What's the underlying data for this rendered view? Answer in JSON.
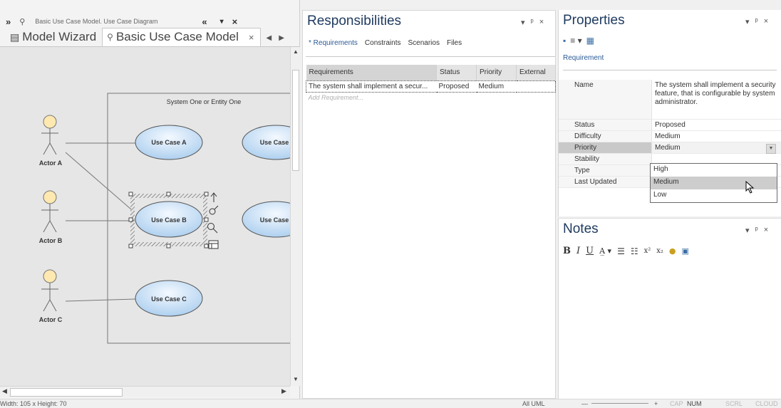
{
  "diagram_window": {
    "header_expand": "»",
    "header_title": "Basic Use Case Model.  Use Case Diagram",
    "header_collapse": "«",
    "header_menu": "▾",
    "header_close": "×",
    "tabs": [
      {
        "label": "Model Wizard",
        "icon": "model-wizard-icon"
      },
      {
        "label": "Basic Use Case Model",
        "icon": "use-case-model-icon"
      }
    ],
    "tab_close": "×",
    "tab_prev": "◀",
    "tab_next": "▶"
  },
  "diagram": {
    "boundary_label": "System One or Entity One",
    "actors": [
      {
        "label": "Actor A"
      },
      {
        "label": "Actor B"
      },
      {
        "label": "Actor C"
      }
    ],
    "use_cases": [
      {
        "label": "Use Case A"
      },
      {
        "label": "Use Case"
      },
      {
        "label": "Use Case B"
      },
      {
        "label": "Use Case"
      },
      {
        "label": "Use Case C"
      }
    ]
  },
  "responsibilities": {
    "title": "Responsibilities",
    "controls": [
      "▾",
      "ᵖ",
      "×"
    ],
    "tabs": [
      "* Requirements",
      "Constraints",
      "Scenarios",
      "Files"
    ],
    "columns": [
      "Requirements",
      "Status",
      "Priority",
      "External"
    ],
    "rows": [
      {
        "requirement": "The system shall implement a secur...",
        "status": "Proposed",
        "priority": "Medium",
        "external": ""
      }
    ],
    "add_placeholder": "Add Requirement..."
  },
  "properties": {
    "title": "Properties",
    "controls": [
      "▾",
      "ᵖ",
      "×"
    ],
    "tab": "Requirement",
    "rows": [
      {
        "key": "Name",
        "value": "The system shall implement a security feature, that is configurable by system administrator."
      },
      {
        "key": "Status",
        "value": "Proposed"
      },
      {
        "key": "Difficulty",
        "value": "Medium"
      },
      {
        "key": "Priority",
        "value": "Medium"
      },
      {
        "key": "Stability",
        "value": ""
      },
      {
        "key": "Type",
        "value": ""
      },
      {
        "key": "Last Updated",
        "value": ""
      }
    ],
    "priority_options": [
      "High",
      "Medium",
      "Low"
    ],
    "priority_selected": "Medium"
  },
  "notes": {
    "title": "Notes",
    "controls": [
      "▾",
      "ᵖ",
      "×"
    ],
    "toolbar": [
      "B",
      "I",
      "U"
    ]
  },
  "status_bar": {
    "dimensions": "Width:  105 x Height:  70",
    "mode": "All UML",
    "zoom_minus": "—",
    "zoom_plus": "+",
    "indicators": [
      "CAP",
      "NUM",
      "SCRL",
      "CLOUD"
    ]
  }
}
